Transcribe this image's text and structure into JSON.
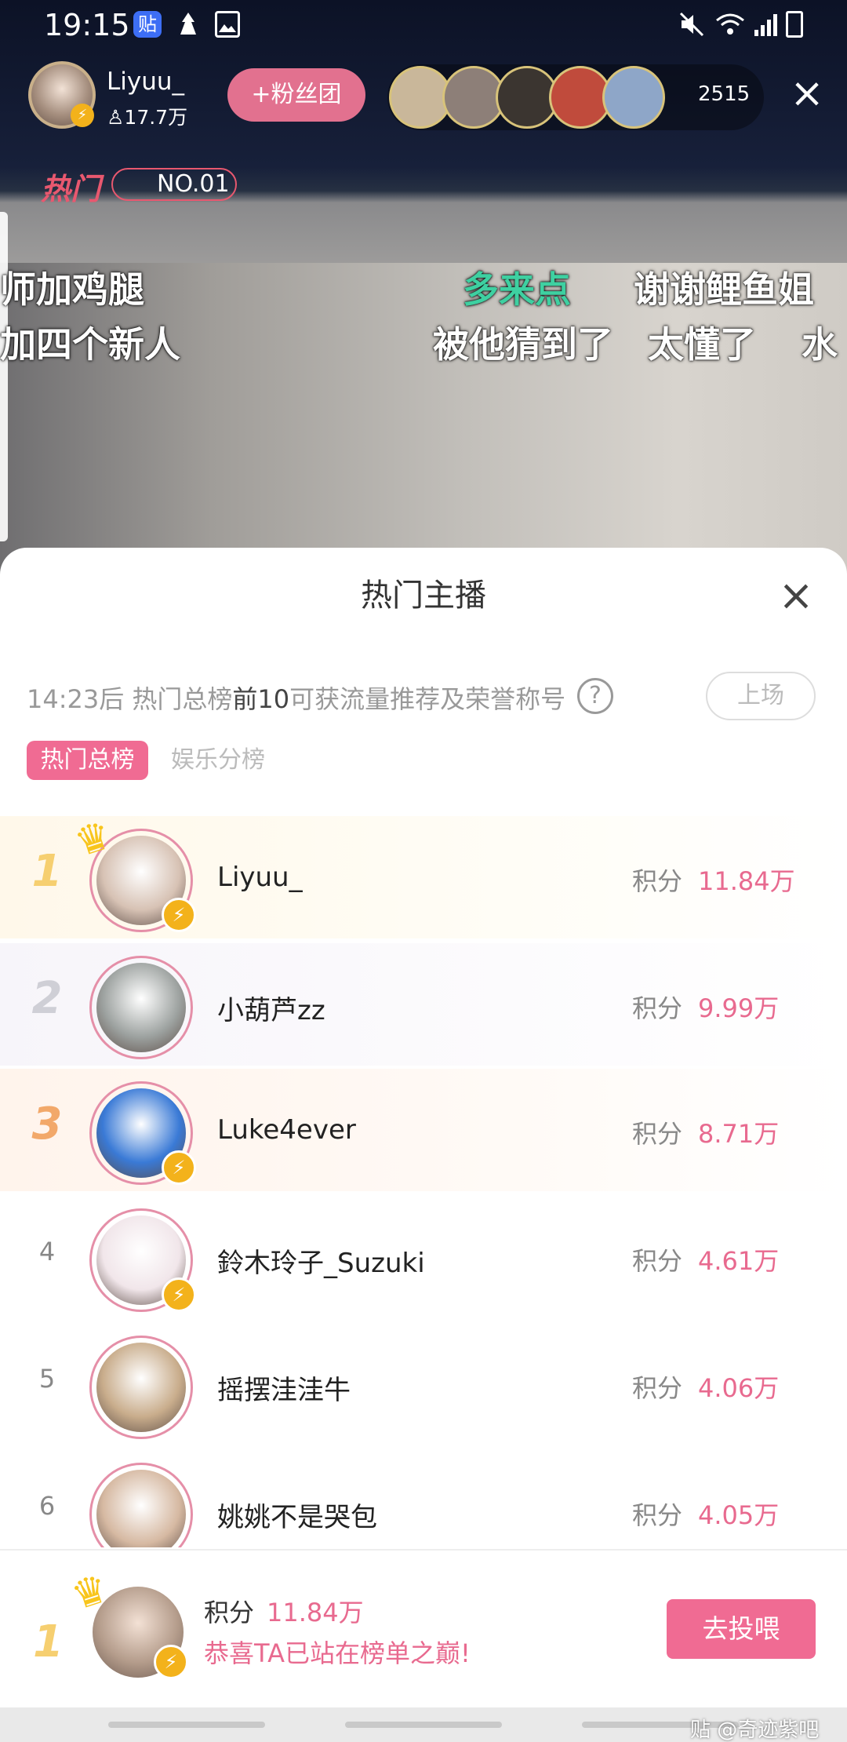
{
  "status_bar": {
    "time": "19:15",
    "notif_app": "贴"
  },
  "stream": {
    "host_name": "Liyuu_",
    "host_fans": "17.7万",
    "fan_club_button": "+粉丝团",
    "viewer_count": "2515",
    "hot_rank_label": "热门",
    "hot_rank_no": "NO.01",
    "viewer_colors": [
      "#c9b79a",
      "#8d7f78",
      "#3b3530",
      "#c04b3c",
      "#8ea6c8"
    ]
  },
  "danmaku": [
    "师加鸡腿",
    "多来点",
    "谢谢鲤鱼姐",
    "加四个新人",
    "被他猜到了",
    "太懂了",
    "水"
  ],
  "sheet": {
    "title": "热门主播",
    "countdown": "14:23后 热门总榜",
    "countdown_strong": "前10",
    "countdown_tail": "可获流量推荐及荣誉称号",
    "help": "?",
    "join_button": "上场",
    "tab_total": "热门总榜",
    "tab_ent": "娱乐分榜"
  },
  "score_label": "积分",
  "ranking": [
    {
      "rank": "1",
      "name": "Liyuu_",
      "score": "11.84万",
      "avatar_color": "#d7c2b4",
      "badge": true,
      "crown": true
    },
    {
      "rank": "2",
      "name": "小葫芦zz",
      "score": "9.99万",
      "avatar_color": "#9da2a0",
      "badge": false,
      "crown": false
    },
    {
      "rank": "3",
      "name": "Luke4ever",
      "score": "8.71万",
      "avatar_color": "#3a7ad6",
      "badge": true,
      "crown": false
    },
    {
      "rank": "4",
      "name": "鈴木玲子_Suzuki",
      "score": "4.61万",
      "avatar_color": "#f1e6ea",
      "badge": true,
      "crown": false
    },
    {
      "rank": "5",
      "name": "摇摆洼洼牛",
      "score": "4.06万",
      "avatar_color": "#c9ad8c",
      "badge": false,
      "crown": false
    },
    {
      "rank": "6",
      "name": "姚姚不是哭包",
      "score": "4.05万",
      "avatar_color": "#d6b9a2",
      "badge": false,
      "crown": false
    }
  ],
  "footer": {
    "rank": "1",
    "score": "11.84万",
    "congrats": "恭喜TA已站在榜单之巅!",
    "vote_button": "去投喂"
  },
  "watermark": "贴 @奇迹紫吧",
  "colors": {
    "accent": "#f06b93",
    "score": "#e86a8f",
    "gold": "#f3b21b"
  }
}
